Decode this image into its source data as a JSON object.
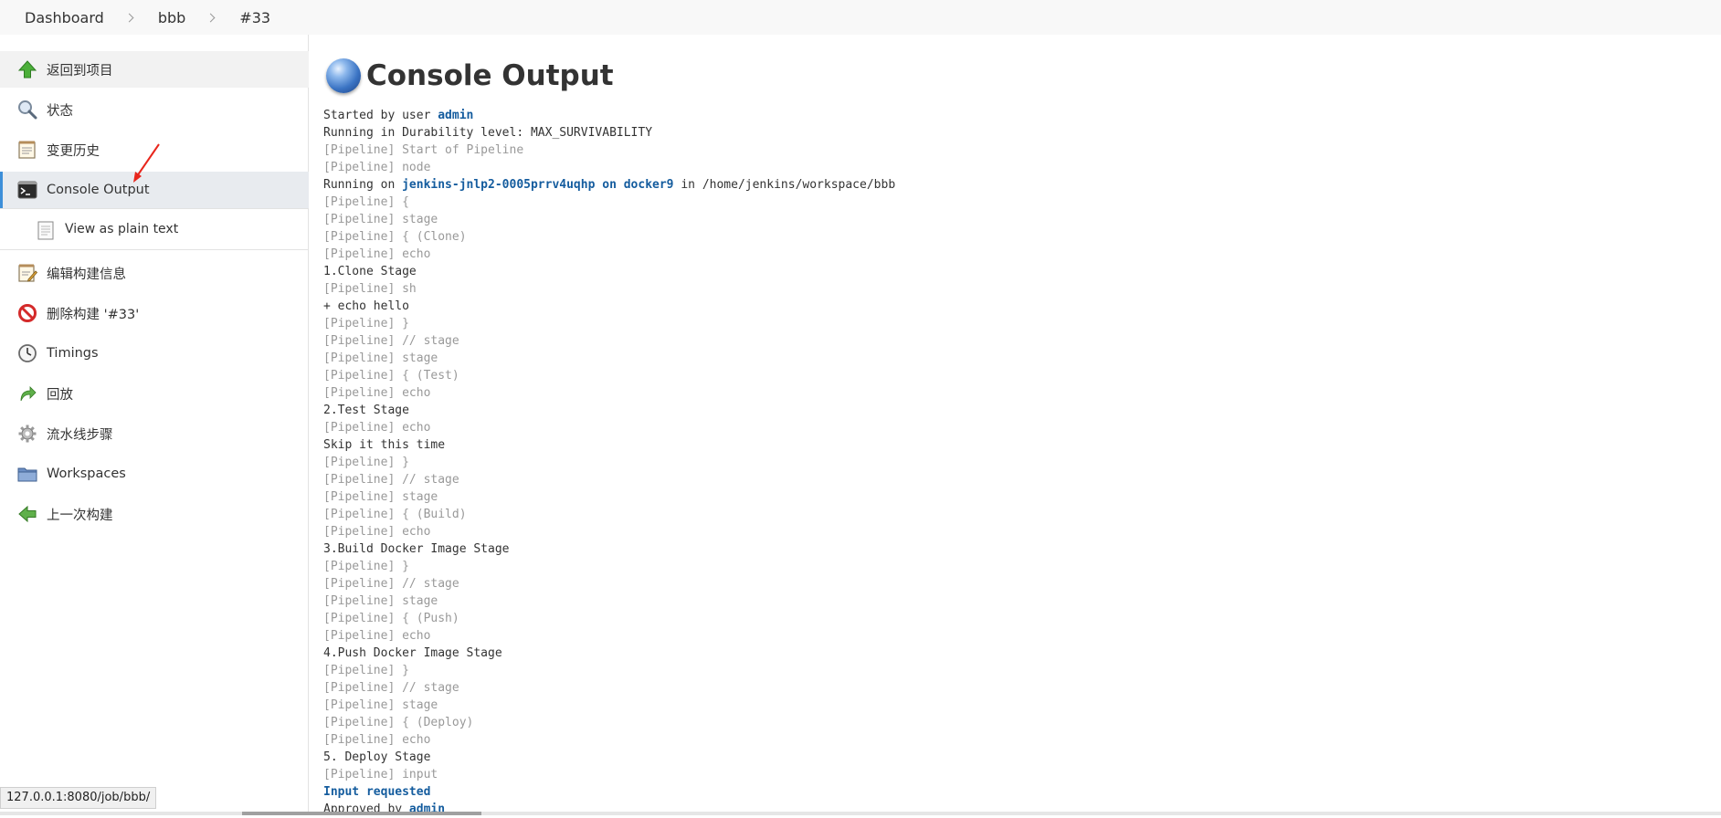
{
  "breadcrumb": {
    "items": [
      "Dashboard",
      "bbb",
      "#33"
    ]
  },
  "sidebar": {
    "items": [
      {
        "label": "返回到项目",
        "icon": "up-arrow-icon"
      },
      {
        "label": "状态",
        "icon": "magnifier-icon"
      },
      {
        "label": "变更历史",
        "icon": "notepad-icon"
      },
      {
        "label": "Console Output",
        "icon": "terminal-icon"
      },
      {
        "label": "View as plain text",
        "icon": "document-icon"
      },
      {
        "label": "编辑构建信息",
        "icon": "notepad-pencil-icon"
      },
      {
        "label": "删除构建 '#33'",
        "icon": "no-entry-icon"
      },
      {
        "label": "Timings",
        "icon": "clock-icon"
      },
      {
        "label": "回放",
        "icon": "redo-arrow-icon"
      },
      {
        "label": "流水线步骤",
        "icon": "gear-icon"
      },
      {
        "label": "Workspaces",
        "icon": "folder-icon"
      },
      {
        "label": "上一次构建",
        "icon": "left-arrow-icon"
      }
    ]
  },
  "main": {
    "title": "Console Output",
    "console": {
      "started_prefix": "Started by user ",
      "started_user": "admin",
      "durability": "Running in Durability level: MAX_SURVIVABILITY",
      "l_start": "[Pipeline] Start of Pipeline",
      "l_node": "[Pipeline] node",
      "running_on_prefix": "Running on ",
      "running_on_link": "jenkins-jnlp2-0005prrv4uqhp on docker9",
      "running_on_suffix": " in /home/jenkins/workspace/bbb",
      "l1": "[Pipeline] {",
      "l2": "[Pipeline] stage",
      "l3": "[Pipeline] { (Clone)",
      "l4": "[Pipeline] echo",
      "o1": "1.Clone Stage",
      "l5": "[Pipeline] sh",
      "o2": "+ echo hello",
      "l6": "[Pipeline] }",
      "l7": "[Pipeline] // stage",
      "l8": "[Pipeline] stage",
      "l9": "[Pipeline] { (Test)",
      "l10": "[Pipeline] echo",
      "o3": "2.Test Stage",
      "l11": "[Pipeline] echo",
      "o4": "Skip it this time",
      "l12": "[Pipeline] }",
      "l13": "[Pipeline] // stage",
      "l14": "[Pipeline] stage",
      "l15": "[Pipeline] { (Build)",
      "l16": "[Pipeline] echo",
      "o5": "3.Build Docker Image Stage",
      "l17": "[Pipeline] }",
      "l18": "[Pipeline] // stage",
      "l19": "[Pipeline] stage",
      "l20": "[Pipeline] { (Push)",
      "l21": "[Pipeline] echo",
      "o6": "4.Push Docker Image Stage",
      "l22": "[Pipeline] }",
      "l23": "[Pipeline] // stage",
      "l24": "[Pipeline] stage",
      "l25": "[Pipeline] { (Deploy)",
      "l26": "[Pipeline] echo",
      "o7": "5. Deploy Stage",
      "l27": "[Pipeline] input",
      "input_requested": "Input requested",
      "approved_prefix": "Approved by ",
      "approved_user": "admin"
    }
  },
  "statusbar": {
    "url": "127.0.0.1:8080/job/bbb/"
  },
  "colors": {
    "link": "#145c9e",
    "pipeline_gray": "#999999",
    "active_bar": "#3d8fd9",
    "annotation_red": "#e8261c"
  }
}
